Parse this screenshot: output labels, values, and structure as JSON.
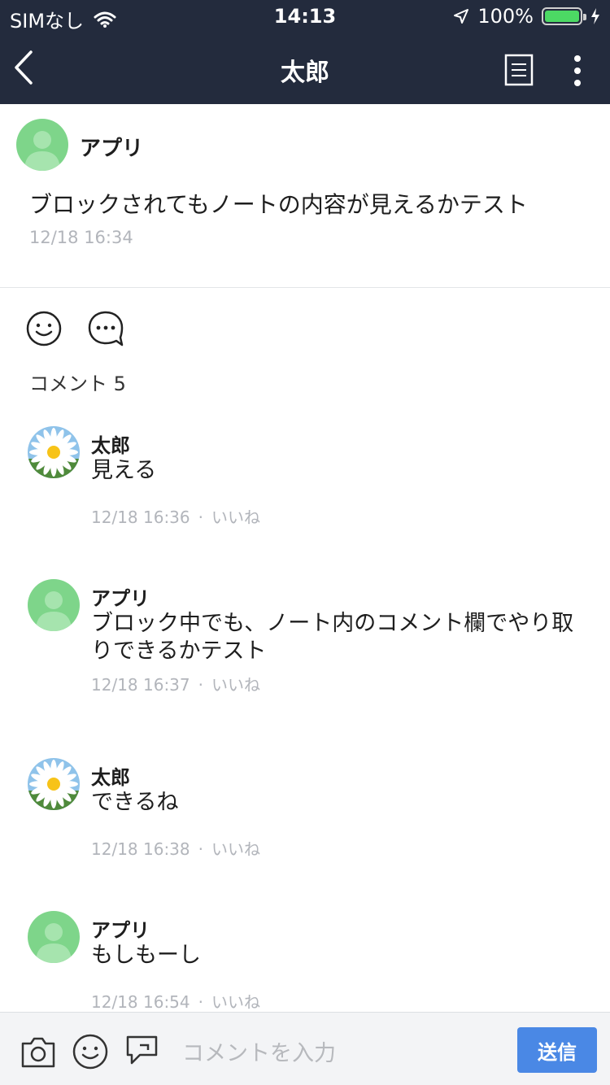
{
  "status_bar": {
    "carrier": "SIMなし",
    "time": "14:13",
    "battery": "100%"
  },
  "navbar": {
    "title": "太郎"
  },
  "post": {
    "user": "アプリ",
    "text": "ブロックされてもノートの内容が見えるかテスト",
    "time": "12/18 16:34"
  },
  "comments_label": "コメント 5",
  "comments": [
    {
      "user": "太郎",
      "text": "見える",
      "time": "12/18 16:36",
      "like": "いいね",
      "avatar": "daisy"
    },
    {
      "user": "アプリ",
      "text": "ブロック中でも、ノート内のコメント欄でやり取りできるかテスト",
      "time": "12/18 16:37",
      "like": "いいね",
      "avatar": "default"
    },
    {
      "user": "太郎",
      "text": "できるね",
      "time": "12/18 16:38",
      "like": "いいね",
      "avatar": "daisy"
    },
    {
      "user": "アプリ",
      "text": "もしもーし",
      "time": "12/18 16:54",
      "like": "いいね",
      "avatar": "default"
    }
  ],
  "footer": {
    "placeholder": "コメントを入力",
    "send_label": "送信"
  },
  "colors": {
    "header_bg": "#232b3d",
    "accent": "#4a88e5",
    "avatar_green": "#7ed58a"
  }
}
